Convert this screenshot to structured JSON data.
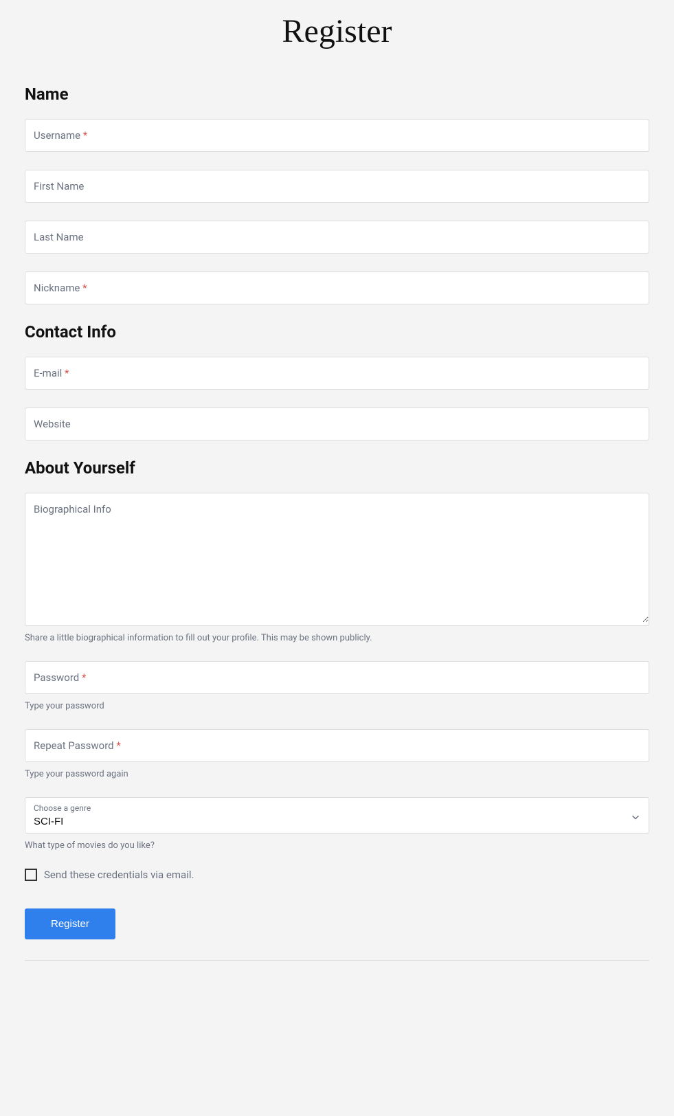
{
  "page_title": "Register",
  "sections": {
    "name": {
      "heading": "Name",
      "fields": {
        "username": {
          "label": "Username",
          "required": true,
          "value": ""
        },
        "first_name": {
          "label": "First Name",
          "required": false,
          "value": ""
        },
        "last_name": {
          "label": "Last Name",
          "required": false,
          "value": ""
        },
        "nickname": {
          "label": "Nickname",
          "required": true,
          "value": ""
        }
      }
    },
    "contact": {
      "heading": "Contact Info",
      "fields": {
        "email": {
          "label": "E-mail",
          "required": true,
          "value": ""
        },
        "website": {
          "label": "Website",
          "required": false,
          "value": ""
        }
      }
    },
    "about": {
      "heading": "About Yourself",
      "bio": {
        "label": "Biographical Info",
        "value": "",
        "helper": "Share a little biographical information to fill out your profile. This may be shown publicly."
      },
      "password": {
        "label": "Password",
        "required": true,
        "value": "",
        "helper": "Type your password"
      },
      "repeat_password": {
        "label": "Repeat Password",
        "required": true,
        "value": "",
        "helper": "Type your password again"
      },
      "genre": {
        "label": "Choose a genre",
        "selected": "SCI-FI",
        "helper": "What type of movies do you like?"
      },
      "send_email_checkbox": {
        "label": "Send these credentials via email.",
        "checked": false
      }
    }
  },
  "submit_label": "Register",
  "required_marker": "*"
}
